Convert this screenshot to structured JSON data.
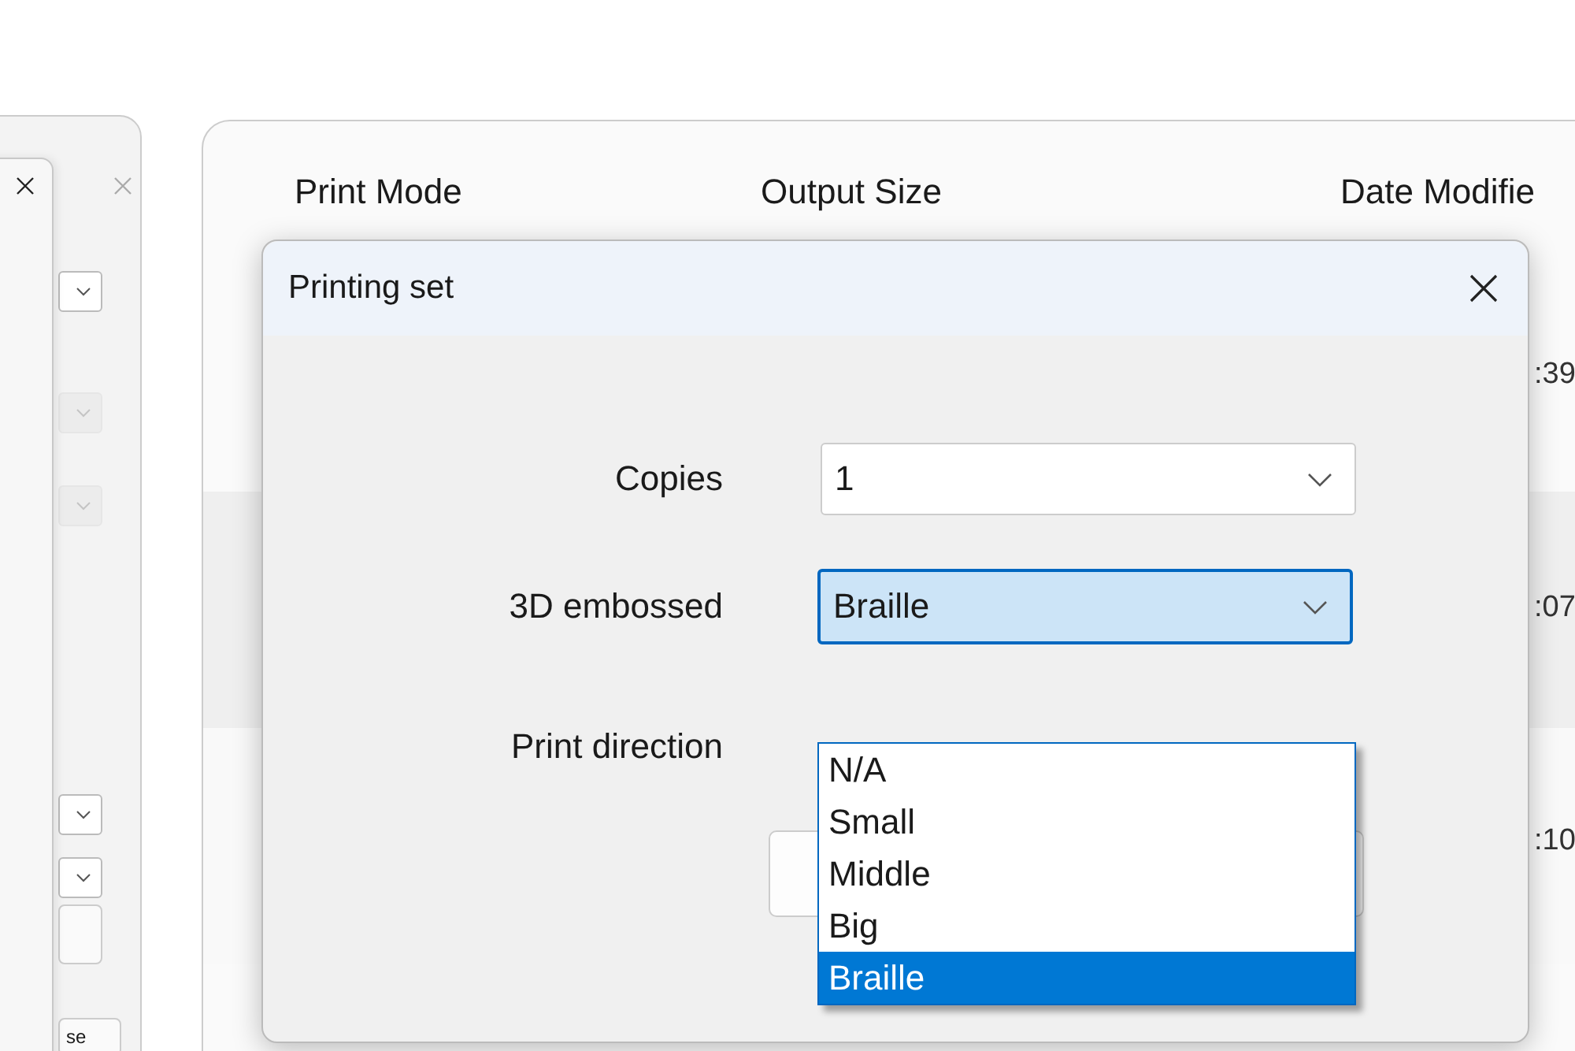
{
  "back_window_left": {
    "combos": [
      {
        "disabled": false
      },
      {
        "disabled": true
      },
      {
        "disabled": true
      },
      {
        "disabled": false
      },
      {
        "disabled": false
      }
    ],
    "button_text": "se"
  },
  "back_window_right": {
    "columns": [
      "Print Mode",
      "Output Size",
      "Date Modifie"
    ],
    "rows": [
      {
        "time": ":39"
      },
      {
        "time": ":07"
      },
      {
        "time": ":10"
      }
    ]
  },
  "dialog": {
    "title": "Printing set",
    "fields": [
      {
        "label": "Copies",
        "value": "1",
        "open": false
      },
      {
        "label": "3D embossed",
        "value": "Braille",
        "open": true
      },
      {
        "label": "Print direction"
      }
    ],
    "dropdown_options": [
      {
        "label": "N/A",
        "selected": false
      },
      {
        "label": "Small",
        "selected": false
      },
      {
        "label": "Middle",
        "selected": false
      },
      {
        "label": "Big",
        "selected": false
      },
      {
        "label": "Braille",
        "selected": true
      }
    ]
  }
}
